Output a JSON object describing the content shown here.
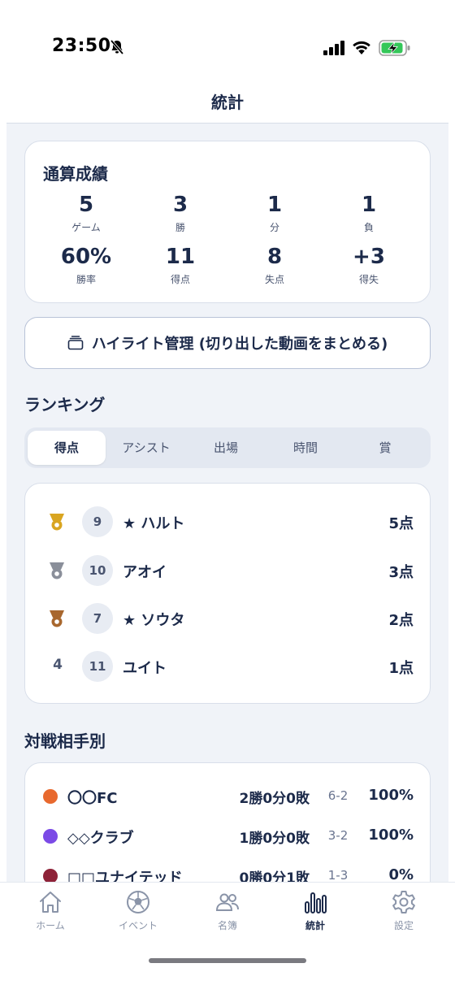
{
  "status": {
    "time": "23:50"
  },
  "header": {
    "title": "統計"
  },
  "summary": {
    "title": "通算成績",
    "stats": [
      {
        "value": "5",
        "label": "ゲーム"
      },
      {
        "value": "3",
        "label": "勝"
      },
      {
        "value": "1",
        "label": "分"
      },
      {
        "value": "1",
        "label": "負"
      },
      {
        "value": "60%",
        "label": "勝率"
      },
      {
        "value": "11",
        "label": "得点"
      },
      {
        "value": "8",
        "label": "失点"
      },
      {
        "value": "+3",
        "label": "得失"
      }
    ]
  },
  "highlight": {
    "label": "ハイライト管理 (切り出した動画をまとめる)"
  },
  "ranking": {
    "title": "ランキング",
    "tabs": [
      "得点",
      "アシスト",
      "出場",
      "時間",
      "賞"
    ],
    "active_tab": "得点",
    "rows": [
      {
        "rank": "1",
        "medal": "gold",
        "jersey": "9",
        "name": "★ ハルト",
        "score": "5点"
      },
      {
        "rank": "2",
        "medal": "silver",
        "jersey": "10",
        "name": "アオイ",
        "score": "3点"
      },
      {
        "rank": "3",
        "medal": "bronze",
        "jersey": "7",
        "name": "★ ソウタ",
        "score": "2点"
      },
      {
        "rank": "4",
        "medal": "",
        "jersey": "11",
        "name": "ユイト",
        "score": "1点"
      }
    ]
  },
  "opponents": {
    "title": "対戦相手別",
    "rows": [
      {
        "color": "#e8692e",
        "name": "〇〇FC",
        "record": "2勝0分0敗",
        "score": "6-2",
        "rate": "100%"
      },
      {
        "color": "#7b4ae6",
        "name": "◇◇クラブ",
        "record": "1勝0分0敗",
        "score": "3-2",
        "rate": "100%"
      },
      {
        "color": "#8e2238",
        "name": "□□ユナイテッド",
        "record": "0勝0分1敗",
        "score": "1-3",
        "rate": "0%"
      }
    ]
  },
  "tabbar": {
    "items": [
      {
        "label": "ホーム",
        "icon": "home-icon"
      },
      {
        "label": "イベント",
        "icon": "soccer-ball-icon"
      },
      {
        "label": "名簿",
        "icon": "people-icon"
      },
      {
        "label": "統計",
        "icon": "bar-chart-icon"
      },
      {
        "label": "設定",
        "icon": "gear-icon"
      }
    ],
    "active": "統計"
  },
  "colors": {
    "text": "#1c2a4a",
    "background": "#f0f3f8",
    "gold": "#d9a520",
    "silver": "#8a8f9a",
    "bronze": "#a8672e"
  }
}
